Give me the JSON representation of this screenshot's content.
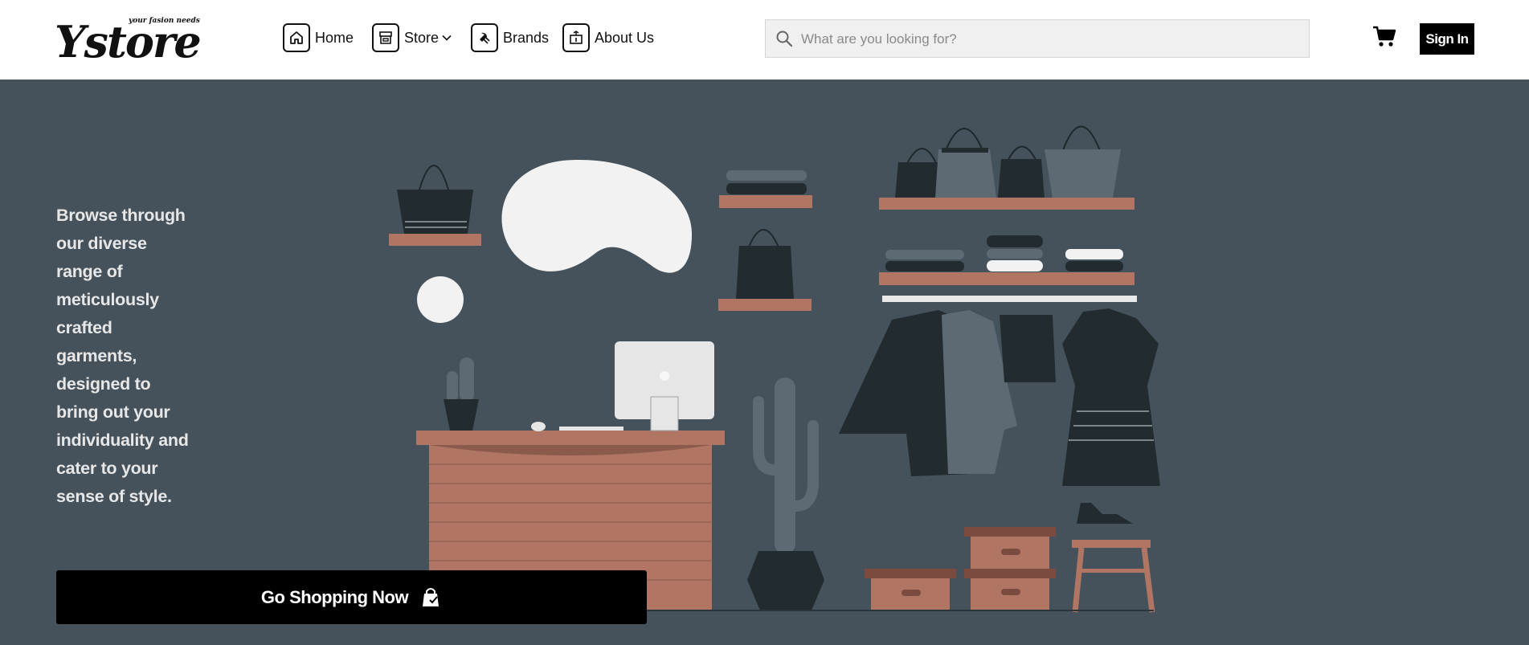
{
  "brand": {
    "name": "Ystore",
    "tagline": "your fasion needs"
  },
  "nav": {
    "home": "Home",
    "store": "Store",
    "brands": "Brands",
    "about": "About Us"
  },
  "search": {
    "placeholder": "What are you looking for?",
    "value": ""
  },
  "header": {
    "sign_in": "Sign In"
  },
  "hero": {
    "text": "Browse through our diverse range of meticulously crafted garments, designed to bring out your individuality and cater to your sense of style.",
    "cta": "Go Shopping Now"
  },
  "icons": {
    "home": "home-icon",
    "store": "store-icon",
    "brands": "hanger-tag-icon",
    "about": "info-box-icon",
    "search": "search-icon",
    "cart": "cart-icon",
    "cta": "shopping-bag-icon"
  },
  "colors": {
    "hero_bg": "#45525b",
    "button_bg": "#000000",
    "terracotta": "#b07563",
    "dark_item": "#2b353b"
  }
}
